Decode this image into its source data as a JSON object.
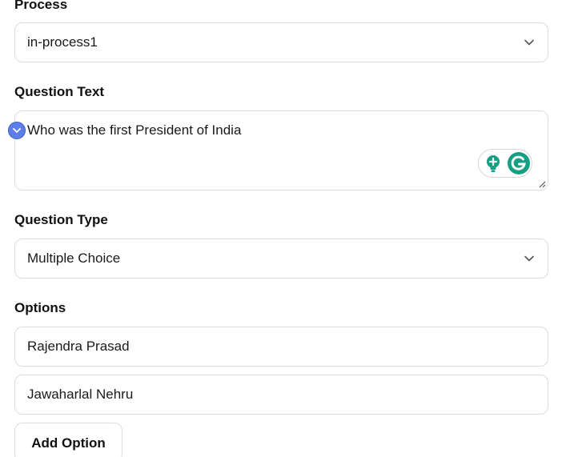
{
  "process": {
    "label": "Process",
    "selected": "in-process1"
  },
  "question_text": {
    "label": "Question Text",
    "value": "Who was the first President of India"
  },
  "question_type": {
    "label": "Question Type",
    "selected": "Multiple Choice"
  },
  "options": {
    "label": "Options",
    "items": [
      "Rajendra Prasad",
      "Jawaharlal Nehru"
    ],
    "add_label": "Add Option"
  },
  "colors": {
    "border": "#dcdcdc",
    "grammarly_green": "#15a085",
    "toggle_blue": "#5b7ee8"
  }
}
